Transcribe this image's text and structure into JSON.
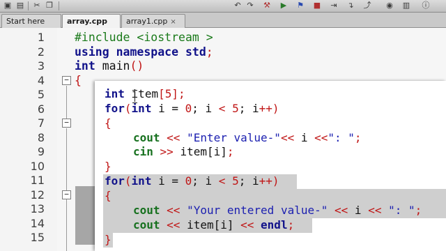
{
  "tabs": [
    {
      "label": "Start here",
      "active": false
    },
    {
      "label": "array.cpp",
      "active": true
    },
    {
      "label": "array1.cpp",
      "active": false
    }
  ],
  "close_glyph": "×",
  "line_numbers": [
    "1",
    "2",
    "3",
    "4",
    "5",
    "6",
    "7",
    "8",
    "9",
    "10",
    "11",
    "12",
    "13",
    "14",
    "15"
  ],
  "fold_expanded_glyph": "−",
  "code": {
    "l1": {
      "dir": "#include",
      "hdr": "<iostream >"
    },
    "l2": {
      "using": "using",
      "ns": "namespace",
      "std": "std",
      "semi": ";"
    },
    "l3": {
      "type": "int",
      "name": "main",
      "parens": "()"
    },
    "l4": {
      "brace": "{"
    }
  },
  "zoom_code": {
    "l5": {
      "type": "int",
      "var": "item",
      "lb": "[",
      "num": "5",
      "rb": "]",
      "semi": ";"
    },
    "l6": {
      "kw": "for",
      "lp": "(",
      "type": "int",
      "init": " i = ",
      "n0": "0",
      "s1": "; i ",
      "lt": "<",
      "sp": " ",
      "n5": "5",
      "s2": "; i",
      "inc": "++",
      "rp": ")"
    },
    "l7": {
      "brace": "{"
    },
    "l8": {
      "fn": "cout",
      "op1": "<<",
      "str": "\"Enter value-\"",
      "op2": "<<",
      "mid": " i ",
      "op3": "<<",
      "str2": "\": \"",
      "semi": ";"
    },
    "l9": {
      "fn": "cin",
      "op": ">>",
      "rest": " item[i]",
      "semi": ";"
    },
    "l10": {
      "brace": "}"
    },
    "l11": {
      "kw": "for",
      "lp": "(",
      "type": "int",
      "init": " i = ",
      "n0": "0",
      "s1": "; i ",
      "lt": "<",
      "sp": " ",
      "n5": "5",
      "s2": "; i",
      "inc": "++",
      "rp": ")"
    },
    "l12": {
      "brace": "{"
    },
    "l13": {
      "fn": "cout",
      "op1": "<<",
      "str": "\"Your entered value-\"",
      "op2": "<<",
      "mid": " i ",
      "op3": "<<",
      "str2": "\": \"",
      "semi": ";"
    },
    "l14": {
      "fn": "cout",
      "op1": "<<",
      "mid": " item[i] ",
      "op2": "<<",
      "endl": " endl",
      "semi": ";"
    },
    "l15": {
      "brace": "}"
    }
  },
  "toolbar_icons": [
    "save-icon",
    "print-icon",
    "cut-icon",
    "copy-icon",
    "undo-icon",
    "redo-icon",
    "build-icon",
    "run-icon",
    "debug-icon",
    "stop-icon"
  ]
}
